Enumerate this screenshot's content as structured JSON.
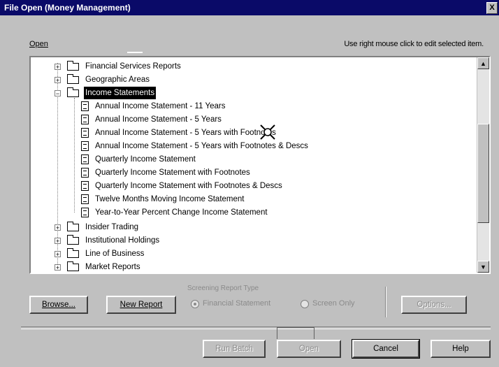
{
  "window": {
    "title": "File Open   (Money Management)",
    "close_glyph": "X"
  },
  "header": {
    "open_label": "Open",
    "hint": "Use right mouse click to edit selected item."
  },
  "tree": {
    "items": [
      {
        "label": "Financial Services Reports",
        "level": 0,
        "type": "folder",
        "expander": "+"
      },
      {
        "label": "Geographic Areas",
        "level": 0,
        "type": "folder",
        "expander": "+"
      },
      {
        "label": "Income Statements",
        "level": 0,
        "type": "folder",
        "expander": "-",
        "selected": true
      },
      {
        "label": "Annual Income Statement - 11 Years",
        "level": 1,
        "type": "doc"
      },
      {
        "label": "Annual Income Statement - 5 Years",
        "level": 1,
        "type": "doc"
      },
      {
        "label": "Annual Income Statement - 5 Years with Footnotes",
        "level": 1,
        "type": "doc"
      },
      {
        "label": "Annual Income Statement - 5 Years with Footnotes & Descs",
        "level": 1,
        "type": "doc"
      },
      {
        "label": "Quarterly Income Statement",
        "level": 1,
        "type": "doc"
      },
      {
        "label": "Quarterly Income Statement with Footnotes",
        "level": 1,
        "type": "doc"
      },
      {
        "label": "Quarterly Income Statement with Footnotes & Descs",
        "level": 1,
        "type": "doc"
      },
      {
        "label": "Twelve Months Moving Income Statement",
        "level": 1,
        "type": "doc"
      },
      {
        "label": "Year-to-Year Percent Change Income Statement",
        "level": 1,
        "type": "doc"
      },
      {
        "label": "Insider Trading",
        "level": 0,
        "type": "folder",
        "expander": "+"
      },
      {
        "label": "Institutional Holdings",
        "level": 0,
        "type": "folder",
        "expander": "+"
      },
      {
        "label": "Line of Business",
        "level": 0,
        "type": "folder",
        "expander": "+"
      },
      {
        "label": "Market Reports",
        "level": 0,
        "type": "folder",
        "expander": "+"
      }
    ]
  },
  "scrollbar": {
    "up_glyph": "▲",
    "down_glyph": "▼"
  },
  "buttons": {
    "browse": "Browse...",
    "new_report": "New Report",
    "options": "Options...",
    "run_batch": "Run Batch",
    "ok": "Open",
    "cancel": "Cancel",
    "help": "Help"
  },
  "report_type": {
    "label": "Screening Report Type",
    "options": [
      {
        "label": "Financial Statement",
        "selected": true
      },
      {
        "label": "Screen Only",
        "selected": false
      }
    ]
  },
  "icons": {
    "expander": "tree-expander-icon",
    "folder": "folder-icon",
    "document": "document-icon",
    "cursor": "busy-cursor-icon"
  },
  "colors": {
    "titlebar": "#0a0a68",
    "selection": "#000000",
    "face": "#c0c0c0"
  }
}
